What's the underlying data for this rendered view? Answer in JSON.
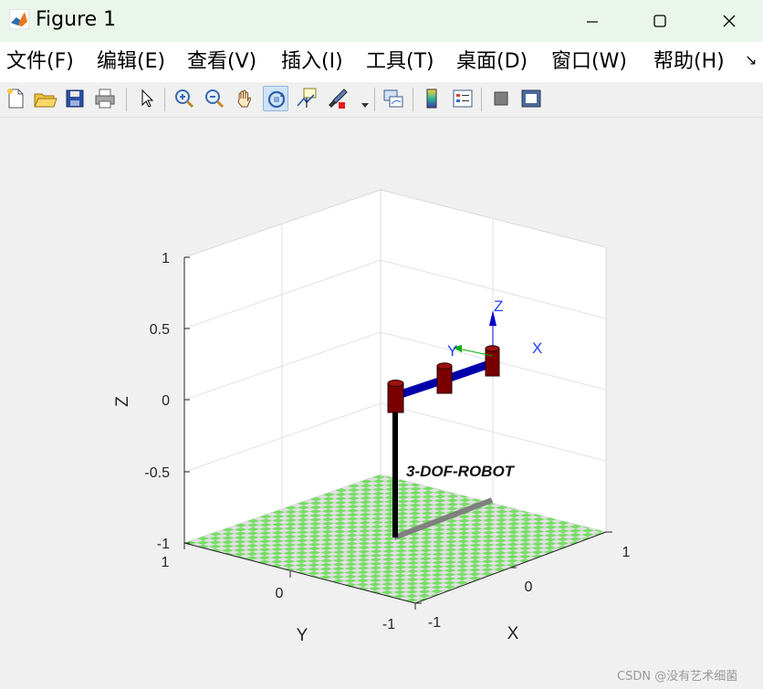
{
  "window": {
    "title": "Figure 1",
    "minimize_glyph": "—",
    "maximize_glyph": "☐",
    "close_glyph": "✕"
  },
  "menu": [
    {
      "label": "文件(F)"
    },
    {
      "label": "编辑(E)"
    },
    {
      "label": "查看(V)"
    },
    {
      "label": "插入(I)"
    },
    {
      "label": "工具(T)"
    },
    {
      "label": "桌面(D)"
    },
    {
      "label": "窗口(W)"
    },
    {
      "label": "帮助(H)"
    }
  ],
  "menu_overflow_glyph": "↘",
  "toolbar_icons": [
    "new-figure-icon",
    "open-folder-icon",
    "save-icon",
    "print-icon",
    "select-arrow-icon",
    "zoom-in-icon",
    "zoom-out-icon",
    "pan-hand-icon",
    "rotate-3d-icon",
    "data-cursor-icon",
    "brush-icon",
    "link-plot-icon",
    "colorbar-icon",
    "legend-icon",
    "hide-plot-tools-icon",
    "show-plot-tools-icon"
  ],
  "plot": {
    "text_label": "3-DOF-ROBOT",
    "axis_labels": {
      "x": "X",
      "y": "Y",
      "z": "Z"
    },
    "z_ticks": [
      "1",
      "0.5",
      "0",
      "-0.5",
      "-1"
    ],
    "y_ticks": [
      "1",
      "0",
      "-1"
    ],
    "x_ticks": [
      "-1",
      "0",
      "1"
    ],
    "frame_labels": {
      "z": "Z",
      "y": "Y",
      "x": "X"
    }
  },
  "colors": {
    "title_bg": "#eaf6ea",
    "link": "#0000cc",
    "joint": "#7a0000",
    "floor_a": "#77dd66",
    "floor_b": "#e0e0e0",
    "frame_blue": "#0000c8",
    "frame_green": "#00aa00"
  },
  "watermark": "CSDN @没有艺术细菌"
}
